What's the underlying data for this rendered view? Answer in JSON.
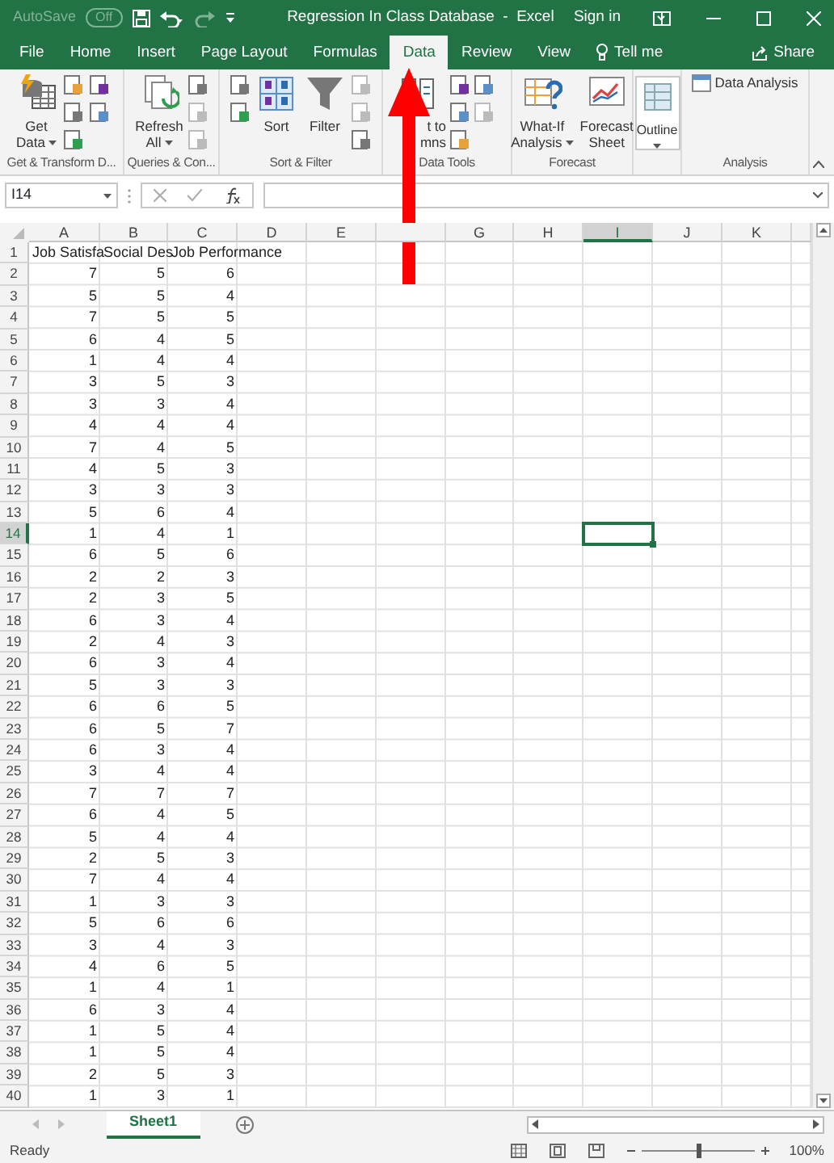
{
  "title_bar": {
    "autosave_label": "AutoSave",
    "autosave": {
      "label": "Off",
      "on": false
    },
    "title": "Regression In Class Database  -  Excel",
    "sign_in": "Sign in"
  },
  "tabs": [
    {
      "label": "File",
      "selected": false
    },
    {
      "label": "Home",
      "selected": false
    },
    {
      "label": "Insert",
      "selected": false
    },
    {
      "label": "Page Layout",
      "selected": false
    },
    {
      "label": "Formulas",
      "selected": false
    },
    {
      "label": "Data",
      "selected": true
    },
    {
      "label": "Review",
      "selected": false
    },
    {
      "label": "View",
      "selected": false
    }
  ],
  "tell_me": "Tell me",
  "share": "Share",
  "ribbon_groups": [
    {
      "label": "Get & Transform D...",
      "items": [
        {
          "kind": "large",
          "label": [
            "Get",
            "Data"
          ],
          "dropdown": true
        },
        {
          "kind": "icons",
          "count_icons": [
            {
              "disabled": false
            },
            {
              "disabled": false
            },
            {
              "disabled": false
            },
            {
              "disabled": false
            },
            {
              "disabled": false
            }
          ]
        }
      ]
    },
    {
      "label": "Queries & Con...",
      "items": [
        {
          "kind": "large",
          "label": [
            "Refresh",
            "All"
          ],
          "dropdown": true
        },
        {
          "kind": "icons",
          "count_icons": [
            {
              "disabled": false
            },
            {
              "disabled": true
            },
            {
              "disabled": true
            }
          ]
        }
      ]
    },
    {
      "label": "Sort & Filter",
      "items": [
        {
          "kind": "icons",
          "count_icons": [
            {
              "disabled": false
            },
            {
              "disabled": false
            }
          ]
        },
        {
          "kind": "large",
          "label": [
            "Sort"
          ],
          "dropdown": false
        },
        {
          "kind": "large",
          "label": [
            "Filter"
          ],
          "dropdown": false
        },
        {
          "kind": "icons",
          "count_icons": [
            {
              "disabled": true
            },
            {
              "disabled": true
            },
            {
              "disabled": false
            }
          ]
        }
      ]
    },
    {
      "label": "Data Tools",
      "items": [
        {
          "kind": "large",
          "label": [
            "t to",
            "mns"
          ],
          "dropdown": false
        },
        {
          "kind": "icons",
          "count_icons": [
            {
              "disabled": false
            },
            {
              "disabled": false
            },
            {
              "disabled": false
            }
          ]
        },
        {
          "kind": "icons",
          "count_icons": [
            {
              "disabled": false
            },
            {
              "disabled": true
            }
          ]
        }
      ]
    },
    {
      "label": "Forecast",
      "items": [
        {
          "kind": "large",
          "label": [
            "What-If",
            "Analysis"
          ],
          "dropdown": true
        },
        {
          "kind": "large",
          "label": [
            "Forecast",
            "Sheet"
          ],
          "dropdown": false
        }
      ]
    },
    {
      "items": [
        {
          "kind": "large",
          "label": [
            "Outline"
          ],
          "dropdown": true
        }
      ]
    },
    {
      "label": "Analysis",
      "items": [
        {
          "kind": "small",
          "label": "Data Analysis"
        }
      ]
    }
  ],
  "name_box": "I14",
  "columns": [
    {
      "label": "A",
      "selected": false
    },
    {
      "label": "B",
      "selected": false
    },
    {
      "label": "C",
      "selected": false
    },
    {
      "label": "D",
      "selected": false
    },
    {
      "label": "E",
      "selected": false
    },
    {
      "selected": false
    },
    {
      "label": "G",
      "selected": false
    },
    {
      "label": "H",
      "selected": false
    },
    {
      "label": "I",
      "selected": true
    },
    {
      "label": "J",
      "selected": false
    },
    {
      "label": "K",
      "selected": false
    }
  ],
  "rows": [
    {
      "number": "1",
      "selected": false,
      "cells": [
        "Job Satisfa",
        "Social Des",
        "Job Performance"
      ]
    },
    {
      "number": "2",
      "selected": false,
      "cells": [
        "7",
        "5",
        "6"
      ]
    },
    {
      "number": "3",
      "selected": false,
      "cells": [
        "5",
        "5",
        "4"
      ]
    },
    {
      "number": "4",
      "selected": false,
      "cells": [
        "7",
        "5",
        "5"
      ]
    },
    {
      "number": "5",
      "selected": false,
      "cells": [
        "6",
        "4",
        "5"
      ]
    },
    {
      "number": "6",
      "selected": false,
      "cells": [
        "1",
        "4",
        "4"
      ]
    },
    {
      "number": "7",
      "selected": false,
      "cells": [
        "3",
        "5",
        "3"
      ]
    },
    {
      "number": "8",
      "selected": false,
      "cells": [
        "3",
        "3",
        "4"
      ]
    },
    {
      "number": "9",
      "selected": false,
      "cells": [
        "4",
        "4",
        "4"
      ]
    },
    {
      "number": "10",
      "selected": false,
      "cells": [
        "7",
        "4",
        "5"
      ]
    },
    {
      "number": "11",
      "selected": false,
      "cells": [
        "4",
        "5",
        "3"
      ]
    },
    {
      "number": "12",
      "selected": false,
      "cells": [
        "3",
        "3",
        "3"
      ]
    },
    {
      "number": "13",
      "selected": false,
      "cells": [
        "5",
        "6",
        "4"
      ]
    },
    {
      "number": "14",
      "selected": true,
      "cells": [
        "1",
        "4",
        "1"
      ]
    },
    {
      "number": "15",
      "selected": false,
      "cells": [
        "6",
        "5",
        "6"
      ]
    },
    {
      "number": "16",
      "selected": false,
      "cells": [
        "2",
        "2",
        "3"
      ]
    },
    {
      "number": "17",
      "selected": false,
      "cells": [
        "2",
        "3",
        "5"
      ]
    },
    {
      "number": "18",
      "selected": false,
      "cells": [
        "6",
        "3",
        "4"
      ]
    },
    {
      "number": "19",
      "selected": false,
      "cells": [
        "2",
        "4",
        "3"
      ]
    },
    {
      "number": "20",
      "selected": false,
      "cells": [
        "6",
        "3",
        "4"
      ]
    },
    {
      "number": "21",
      "selected": false,
      "cells": [
        "5",
        "3",
        "3"
      ]
    },
    {
      "number": "22",
      "selected": false,
      "cells": [
        "6",
        "6",
        "5"
      ]
    },
    {
      "number": "23",
      "selected": false,
      "cells": [
        "6",
        "5",
        "7"
      ]
    },
    {
      "number": "24",
      "selected": false,
      "cells": [
        "6",
        "3",
        "4"
      ]
    },
    {
      "number": "25",
      "selected": false,
      "cells": [
        "3",
        "4",
        "4"
      ]
    },
    {
      "number": "26",
      "selected": false,
      "cells": [
        "7",
        "7",
        "7"
      ]
    },
    {
      "number": "27",
      "selected": false,
      "cells": [
        "6",
        "4",
        "5"
      ]
    },
    {
      "number": "28",
      "selected": false,
      "cells": [
        "5",
        "4",
        "4"
      ]
    },
    {
      "number": "29",
      "selected": false,
      "cells": [
        "2",
        "5",
        "3"
      ]
    },
    {
      "number": "30",
      "selected": false,
      "cells": [
        "7",
        "4",
        "4"
      ]
    },
    {
      "number": "31",
      "selected": false,
      "cells": [
        "1",
        "3",
        "3"
      ]
    },
    {
      "number": "32",
      "selected": false,
      "cells": [
        "5",
        "6",
        "6"
      ]
    },
    {
      "number": "33",
      "selected": false,
      "cells": [
        "3",
        "4",
        "3"
      ]
    },
    {
      "number": "34",
      "selected": false,
      "cells": [
        "4",
        "6",
        "5"
      ]
    },
    {
      "number": "35",
      "selected": false,
      "cells": [
        "1",
        "4",
        "1"
      ]
    },
    {
      "number": "36",
      "selected": false,
      "cells": [
        "6",
        "3",
        "4"
      ]
    },
    {
      "number": "37",
      "selected": false,
      "cells": [
        "1",
        "5",
        "4"
      ]
    },
    {
      "number": "38",
      "selected": false,
      "cells": [
        "1",
        "5",
        "4"
      ]
    },
    {
      "number": "39",
      "selected": false,
      "cells": [
        "2",
        "5",
        "3"
      ]
    },
    {
      "number": "40",
      "selected": false,
      "cells": [
        "1",
        "3",
        "1"
      ]
    }
  ],
  "sheet_tabs": [
    {
      "label": "Sheet1",
      "selected": true
    }
  ],
  "status_bar": {
    "status": "Ready",
    "zoom": {
      "level": 0.5,
      "reading": "100%"
    }
  }
}
